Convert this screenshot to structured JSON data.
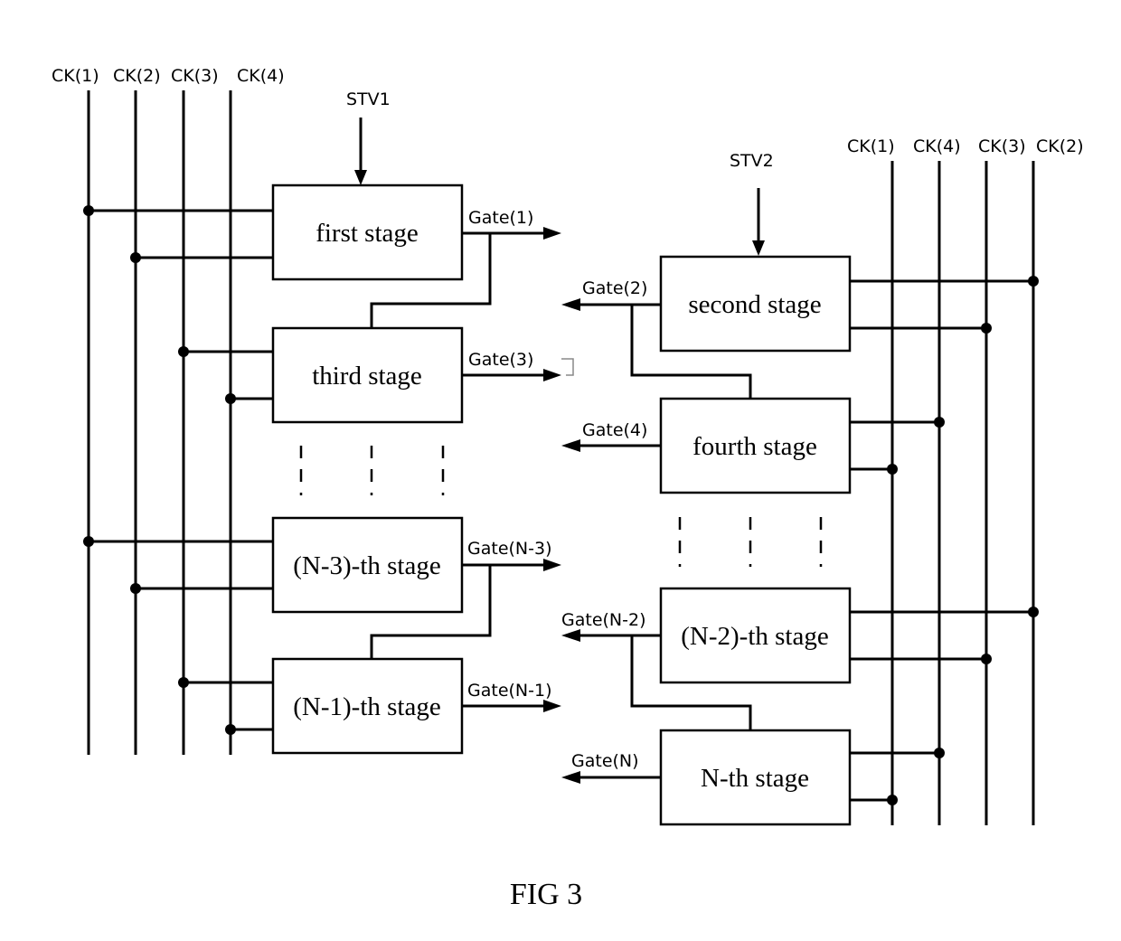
{
  "figure": {
    "caption": "FIG 3",
    "left_clock_labels": [
      "CK(1)",
      "CK(2)",
      "CK(3)",
      "CK(4)"
    ],
    "right_clock_labels": [
      "CK(1)",
      "CK(4)",
      "CK(3)",
      "CK(2)"
    ],
    "start_signals": {
      "left": "STV1",
      "right": "STV2"
    },
    "stages": {
      "first": "first stage",
      "second": "second stage",
      "third": "third stage",
      "fourth": "fourth stage",
      "n_minus_3": "(N-3)-th stage",
      "n_minus_2": "(N-2)-th stage",
      "n_minus_1": "(N-1)-th stage",
      "n": "N-th stage"
    },
    "gates": {
      "g1": "Gate(1)",
      "g2": "Gate(2)",
      "g3": "Gate(3)",
      "g4": "Gate(4)",
      "gn3": "Gate(N-3)",
      "gn2": "Gate(N-2)",
      "gn1": "Gate(N-1)",
      "gn": "Gate(N)"
    }
  }
}
